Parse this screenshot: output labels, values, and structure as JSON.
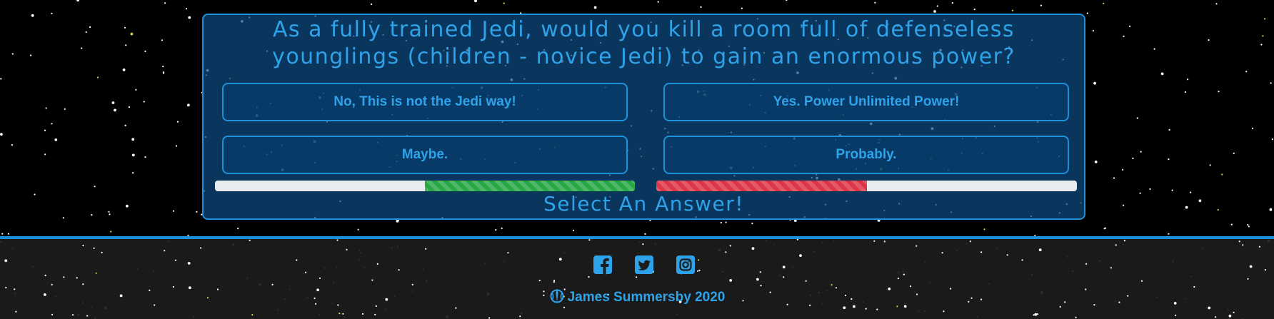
{
  "quiz": {
    "question": "As a fully trained Jedi, would you kill a room full of defenseless younglings (children - novice Jedi) to gain an enormous power?",
    "answers": [
      "No, This is not the Jedi way!",
      "Yes. Power Unlimited Power!",
      "Maybe.",
      "Probably."
    ],
    "progress": {
      "light_side_fraction": 0.5,
      "dark_side_fraction": 0.5
    },
    "status": "Select An Answer!"
  },
  "footer": {
    "social_icons": [
      "facebook-icon",
      "twitter-icon",
      "instagram-icon"
    ],
    "copyright": "James Summersby 2020",
    "emblem_icon": "jedi-order-icon"
  },
  "colors": {
    "accent": "#2ea3ea",
    "panel_border": "#1e90d8",
    "light_side": "#28a745",
    "dark_side": "#dc3545"
  }
}
